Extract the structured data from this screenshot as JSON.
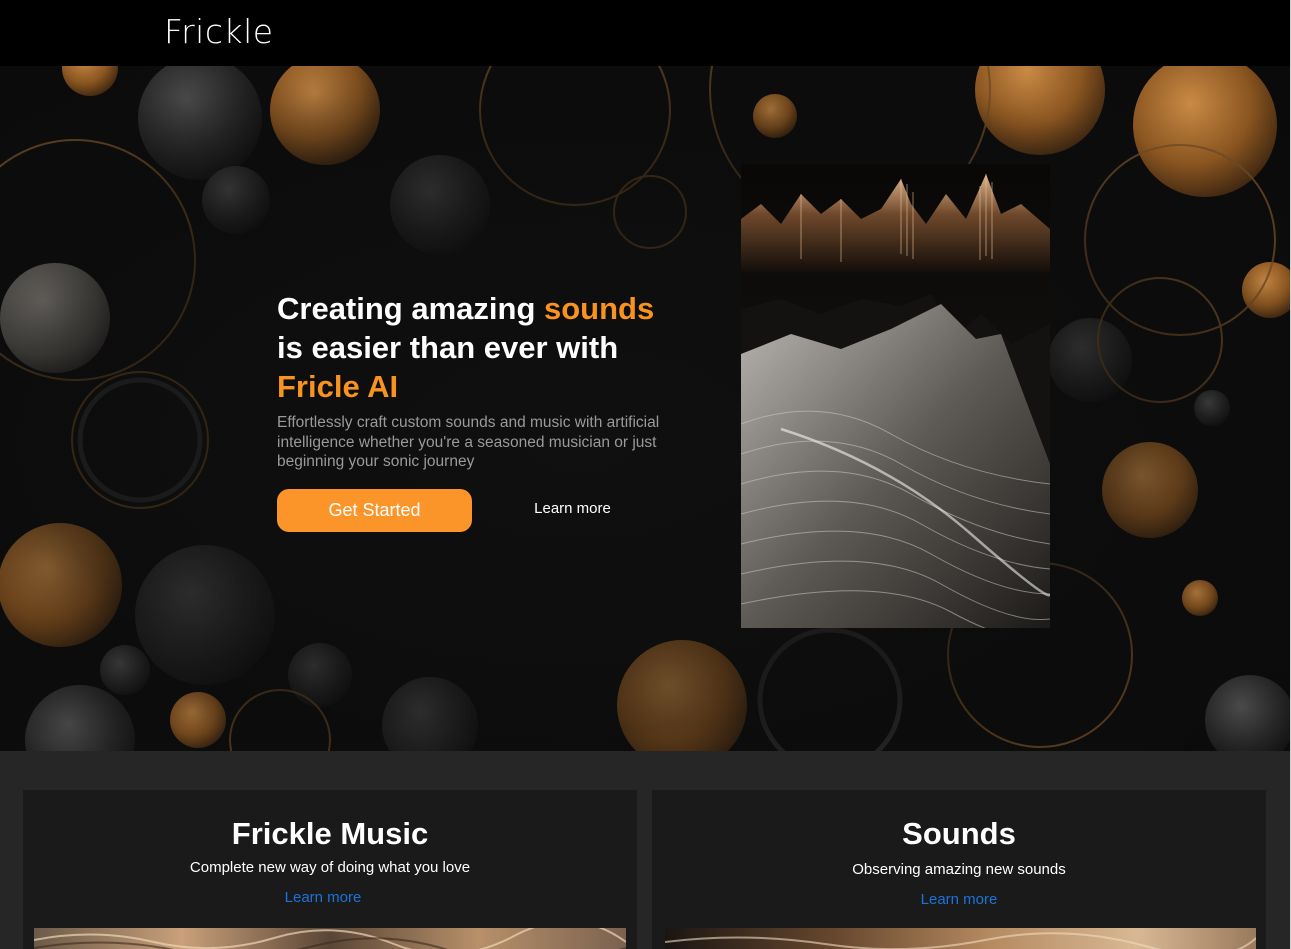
{
  "header": {
    "brand": "Frickle"
  },
  "hero": {
    "headline_part1": "Creating amazing ",
    "headline_accent1": "sounds",
    "headline_part2": "is easier than ever with",
    "headline_accent2": "Fricle AI",
    "subtitle": "Effortlessly craft custom sounds and music with artificial intelligence whether you're a seasoned musician or just beginning your sonic journey",
    "primary_button": "Get Started",
    "secondary_link": "Learn more"
  },
  "cards": [
    {
      "title": "Frickle Music",
      "description": "Complete new way of doing what you love",
      "link": "Learn more"
    },
    {
      "title": "Sounds",
      "description": "Observing amazing new sounds",
      "link": "Learn more"
    }
  ],
  "colors": {
    "accent": "#f7931e",
    "button": "#fb952a",
    "link": "#1a73d9",
    "background": "#262626"
  }
}
